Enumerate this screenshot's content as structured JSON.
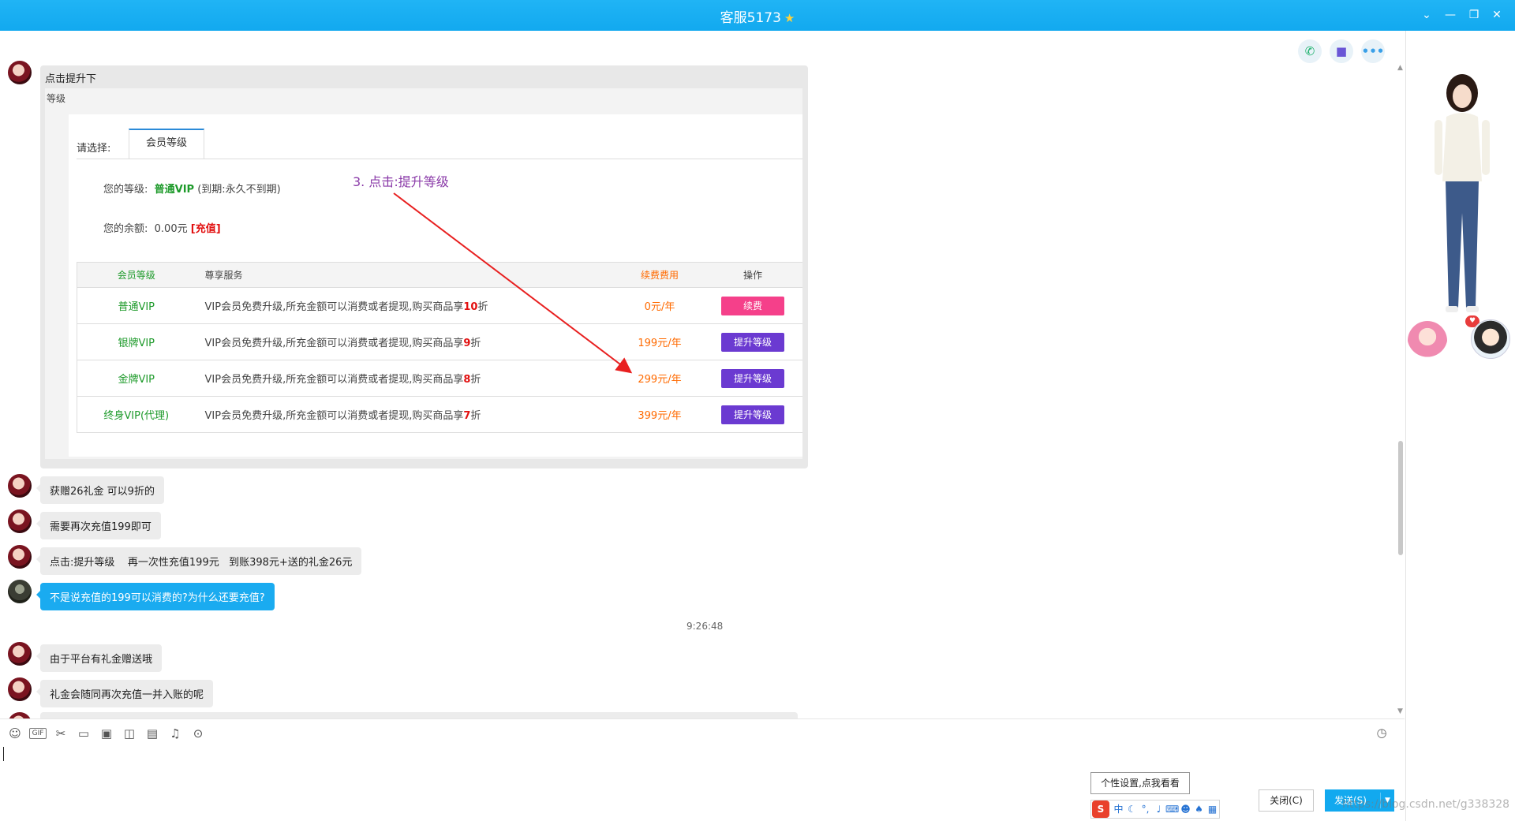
{
  "window": {
    "title": "客服5173",
    "star_icon": "star-icon",
    "controls": [
      "chevron-down-icon",
      "minimize-icon",
      "restore-icon",
      "close-icon"
    ]
  },
  "header_actions": [
    "phone-icon",
    "video-icon",
    "more-icon"
  ],
  "image_message": {
    "caption": "点击提升下",
    "crumb": "等级",
    "tab_prompt": "请选择:",
    "tab_active": "会员等级",
    "level_label": "您的等级:",
    "level_value": "普通VIP",
    "level_expiry": "(到期:永久不到期)",
    "balance_label": "您的余额:",
    "balance_value": "0.00元",
    "recharge_open": "[",
    "recharge_link": "充值",
    "recharge_close": "]",
    "annotation": "3. 点击:提升等级",
    "table": {
      "headers": [
        "会员等级",
        "尊享服务",
        "续费费用",
        "操作"
      ],
      "service_prefix": "VIP会员免费升级,所充金额可以消费或者提现,购买商品享",
      "service_suffix": "折",
      "rows": [
        {
          "level": "普通VIP",
          "discount": "10",
          "fee": "0元/年",
          "action": "续费"
        },
        {
          "level": "银牌VIP",
          "discount": "9",
          "fee": "199元/年",
          "action": "提升等级"
        },
        {
          "level": "金牌VIP",
          "discount": "8",
          "fee": "299元/年",
          "action": "提升等级"
        },
        {
          "level": "终身VIP(代理)",
          "discount": "7",
          "fee": "399元/年",
          "action": "提升等级"
        }
      ]
    }
  },
  "messages": [
    {
      "from": "agent",
      "text": "获赠26礼金 可以9折的"
    },
    {
      "from": "agent",
      "text": "需要再次充值199即可"
    },
    {
      "from": "agent",
      "text": "点击:提升等级    再一次性充值199元   到账398元+送的礼金26元"
    },
    {
      "from": "me",
      "text": "不是说充值的199可以消费的?为什么还要充值?"
    },
    {
      "from": "agent",
      "text": "由于平台有礼金赠送哦"
    },
    {
      "from": "agent",
      "text": "礼金会随同再次充值一并入账的呢"
    }
  ],
  "timestamp": "9:26:48",
  "toolbar_icons": [
    "emoji-icon",
    "gif-icon",
    "scissors-icon",
    "folder-icon",
    "image-icon",
    "shake-icon",
    "calendar-icon",
    "music-icon",
    "more-icon"
  ],
  "toolbar_gif_label": "GIF",
  "tooltip": "个性设置,点我看看",
  "ime_chars": [
    "中",
    "♪",
    "°,",
    "🎤",
    "⌨",
    "👥",
    "👕",
    "▦"
  ],
  "ime_logo": "S",
  "buttons": {
    "close": "关闭(C)",
    "send": "发送(S)"
  },
  "watermark": "https://blog.csdn.net/g338328"
}
